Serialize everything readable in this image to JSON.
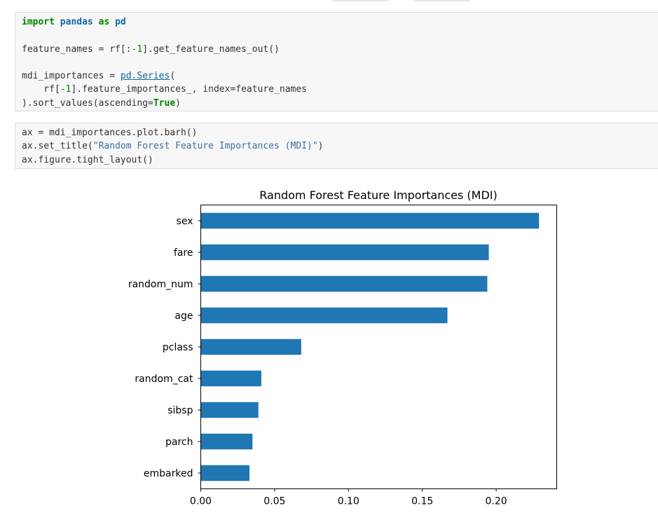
{
  "cells": [
    {
      "lines": [
        [
          {
            "t": "import",
            "c": "kw"
          },
          {
            "t": " "
          },
          {
            "t": "pandas",
            "c": "mod"
          },
          {
            "t": " "
          },
          {
            "t": "as",
            "c": "kw"
          },
          {
            "t": " "
          },
          {
            "t": "pd",
            "c": "mod"
          }
        ],
        [],
        [
          {
            "t": "feature_names = rf[:"
          },
          {
            "t": "-1",
            "c": "num"
          },
          {
            "t": "].get_feature_names_out()"
          }
        ],
        [],
        [
          {
            "t": "mdi_importances = "
          },
          {
            "t": "pd.Series",
            "c": "link"
          },
          {
            "t": "("
          }
        ],
        [
          {
            "t": "    rf["
          },
          {
            "t": "-1",
            "c": "num"
          },
          {
            "t": "].feature_importances_, index=feature_names"
          }
        ],
        [
          {
            "t": ").sort_values(ascending="
          },
          {
            "t": "True",
            "c": "kw"
          },
          {
            "t": ")"
          }
        ]
      ]
    },
    {
      "lines": [
        [
          {
            "t": "ax = mdi_importances.plot.barh()"
          }
        ],
        [
          {
            "t": "ax.set_title("
          },
          {
            "t": "\"Random Forest Feature Importances (MDI)\"",
            "c": "str"
          },
          {
            "t": ")"
          }
        ],
        [
          {
            "t": "ax.figure.tight_layout()"
          }
        ]
      ]
    }
  ],
  "chart_data": {
    "type": "bar",
    "orientation": "horizontal",
    "title": "Random Forest Feature Importances (MDI)",
    "categories": [
      "sex",
      "fare",
      "random_num",
      "age",
      "pclass",
      "random_cat",
      "sibsp",
      "parch",
      "embarked"
    ],
    "values": [
      0.229,
      0.195,
      0.194,
      0.167,
      0.068,
      0.041,
      0.039,
      0.035,
      0.033
    ],
    "xticks": [
      "0.00",
      "0.05",
      "0.10",
      "0.15",
      "0.20"
    ],
    "xlim": [
      0.0,
      0.241
    ],
    "xlabel": "",
    "ylabel": "",
    "bar_color": "#1f77b4",
    "grid": false,
    "legend": false
  }
}
